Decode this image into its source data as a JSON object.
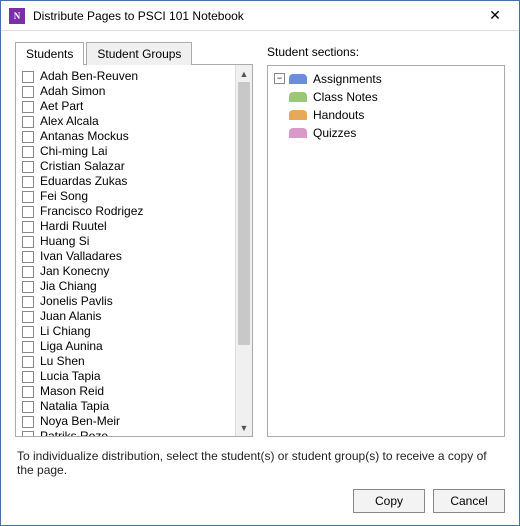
{
  "window": {
    "title": "Distribute Pages to PSCI 101 Notebook",
    "icon": "onenote-icon"
  },
  "tabs": [
    {
      "id": "students",
      "label": "Students",
      "active": true
    },
    {
      "id": "student-groups",
      "label": "Student Groups",
      "active": false
    }
  ],
  "students": [
    "Adah Ben-Reuven",
    "Adah Simon",
    "Aet Part",
    "Alex Alcala",
    "Antanas Mockus",
    "Chi-ming Lai",
    "Cristian Salazar",
    "Eduardas Zukas",
    "Fei Song",
    "Francisco Rodrigez",
    "Hardi Ruutel",
    "Huang Si",
    "Ivan Valladares",
    "Jan Konecny",
    "Jia Chiang",
    "Jonelis Pavlis",
    "Juan Alanis",
    "Li Chiang",
    "Liga Aunina",
    "Lu Shen",
    "Lucia Tapia",
    "Mason Reid",
    "Natalia Tapia",
    "Noya Ben-Meir",
    "Patriks Roze"
  ],
  "sections_heading": "Student sections:",
  "sections": [
    {
      "label": "Assignments",
      "color": "#6a8fd8"
    },
    {
      "label": "Class Notes",
      "color": "#9cc77a"
    },
    {
      "label": "Handouts",
      "color": "#e6a85a"
    },
    {
      "label": "Quizzes",
      "color": "#d99ac9"
    }
  ],
  "hint": "To individualize distribution, select the student(s) or student group(s) to receive a copy of the page.",
  "buttons": {
    "copy": "Copy",
    "cancel": "Cancel"
  }
}
